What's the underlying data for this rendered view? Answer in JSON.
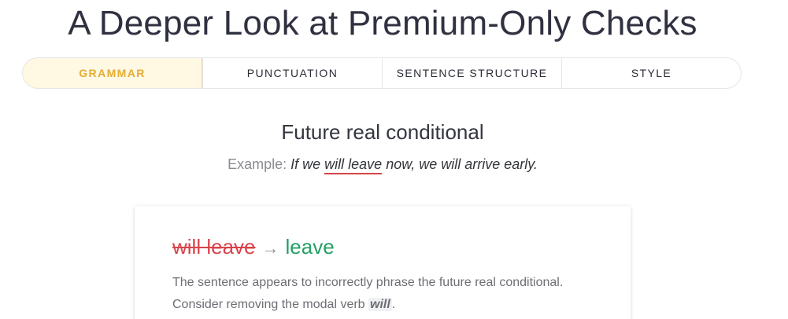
{
  "headline": "A Deeper Look at Premium-Only Checks",
  "tabs": [
    {
      "label": "GRAMMAR",
      "active": true
    },
    {
      "label": "PUNCTUATION",
      "active": false
    },
    {
      "label": "SENTENCE STRUCTURE",
      "active": false
    },
    {
      "label": "STYLE",
      "active": false
    }
  ],
  "section": {
    "title": "Future real conditional",
    "example_label": "Example:",
    "example_before": "If we",
    "example_highlight": "will leave",
    "example_after": "now, we will arrive early."
  },
  "card": {
    "wrong": "will leave",
    "arrow": "→",
    "right": "leave",
    "explanation_before": "The sentence appears to incorrectly phrase the future real conditional. Consider removing the modal verb",
    "explanation_keyword": "will",
    "explanation_after": "."
  },
  "colors": {
    "accent": "#e3ad32",
    "error": "#d9434a",
    "correct": "#24a065"
  }
}
